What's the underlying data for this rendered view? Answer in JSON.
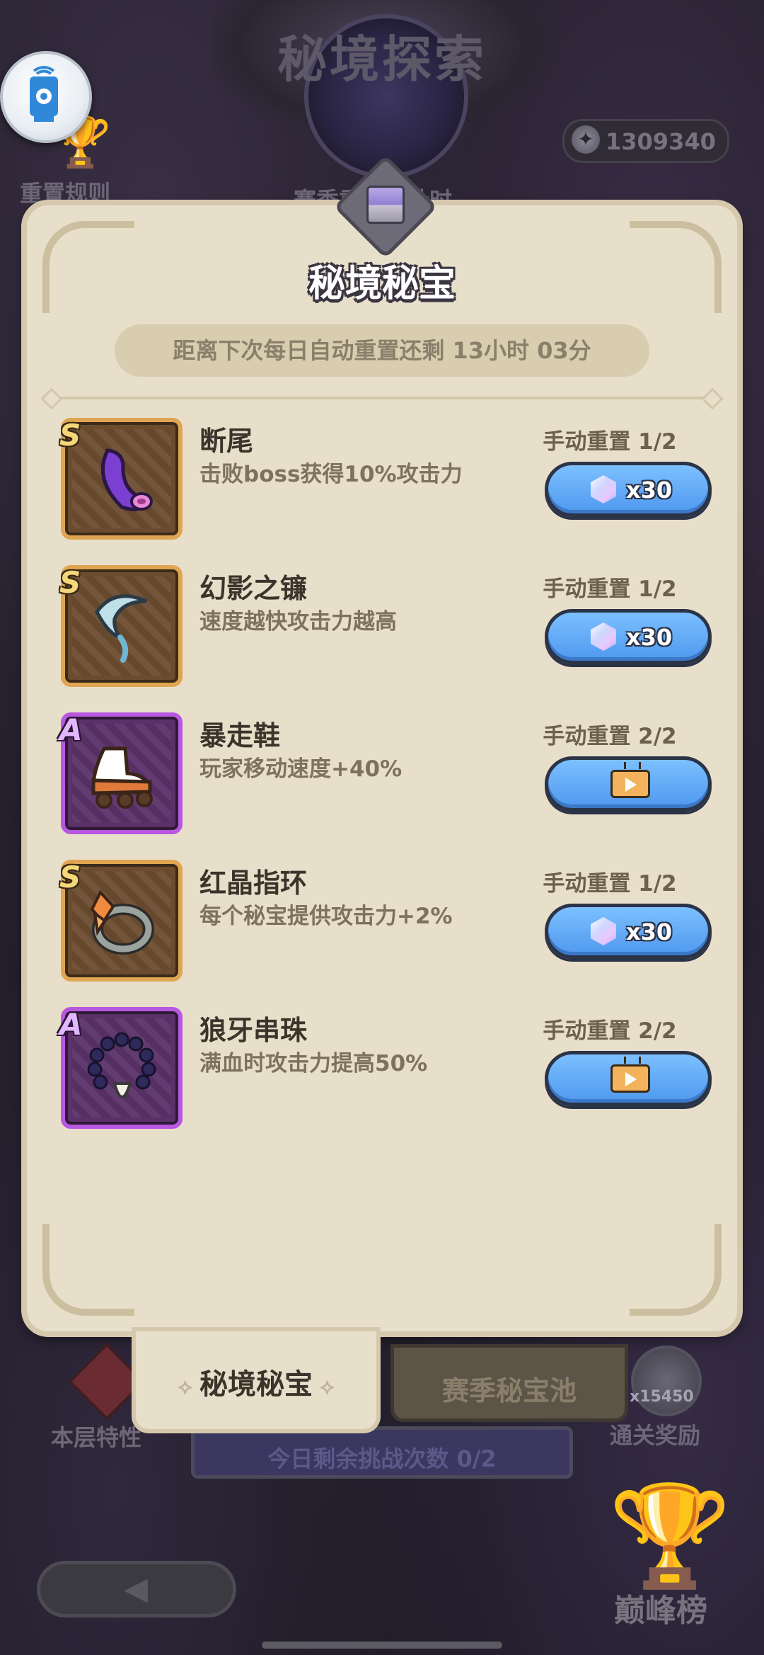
{
  "header": {
    "title": "秘境探索",
    "currency_value": "1309340",
    "rules_label": "重置规则",
    "season_label": "赛季重置倒计时",
    "record_icon": "screen-record-icon",
    "currency_icon": "star-coin-icon"
  },
  "panel": {
    "title": "秘境秘宝",
    "reset_timer": "距离下次每日自动重置还剩 13小时 03分",
    "chest_icon": "treasure-chest-icon"
  },
  "items": [
    {
      "grade": "S",
      "name": "断尾",
      "desc": "击败boss获得10%攻击力",
      "reset": "手动重置 1/2",
      "cost_type": "gem",
      "cost": "x30",
      "art": "tail-icon"
    },
    {
      "grade": "S",
      "name": "幻影之镰",
      "desc": "速度越快攻击力越高",
      "reset": "手动重置 1/2",
      "cost_type": "gem",
      "cost": "x30",
      "art": "sickle-icon"
    },
    {
      "grade": "A",
      "name": "暴走鞋",
      "desc": "玩家移动速度+40%",
      "reset": "手动重置 2/2",
      "cost_type": "video",
      "cost": "",
      "art": "roller-shoe-icon"
    },
    {
      "grade": "S",
      "name": "红晶指环",
      "desc": "每个秘宝提供攻击力+2%",
      "reset": "手动重置 1/2",
      "cost_type": "gem",
      "cost": "x30",
      "art": "crystal-ring-icon"
    },
    {
      "grade": "A",
      "name": "狼牙串珠",
      "desc": "满血时攻击力提高50%",
      "reset": "手动重置 2/2",
      "cost_type": "video",
      "cost": "",
      "art": "fang-beads-icon"
    }
  ],
  "tabs": {
    "secret": "秘境秘宝",
    "season_pool": "赛季秘宝池"
  },
  "footer": {
    "floor_feature": "本层特性",
    "clear_reward": "通关奖励",
    "clear_reward_count": "x15450",
    "challenge_remaining": "今日剩余挑战次数 0/2",
    "leaderboard": "巅峰榜"
  },
  "colors": {
    "panel_bg": "#e8dfcb",
    "grade_s_frame": "#e0a552",
    "grade_a_frame": "#b857e0",
    "button_blue": "#5aa3f2"
  }
}
